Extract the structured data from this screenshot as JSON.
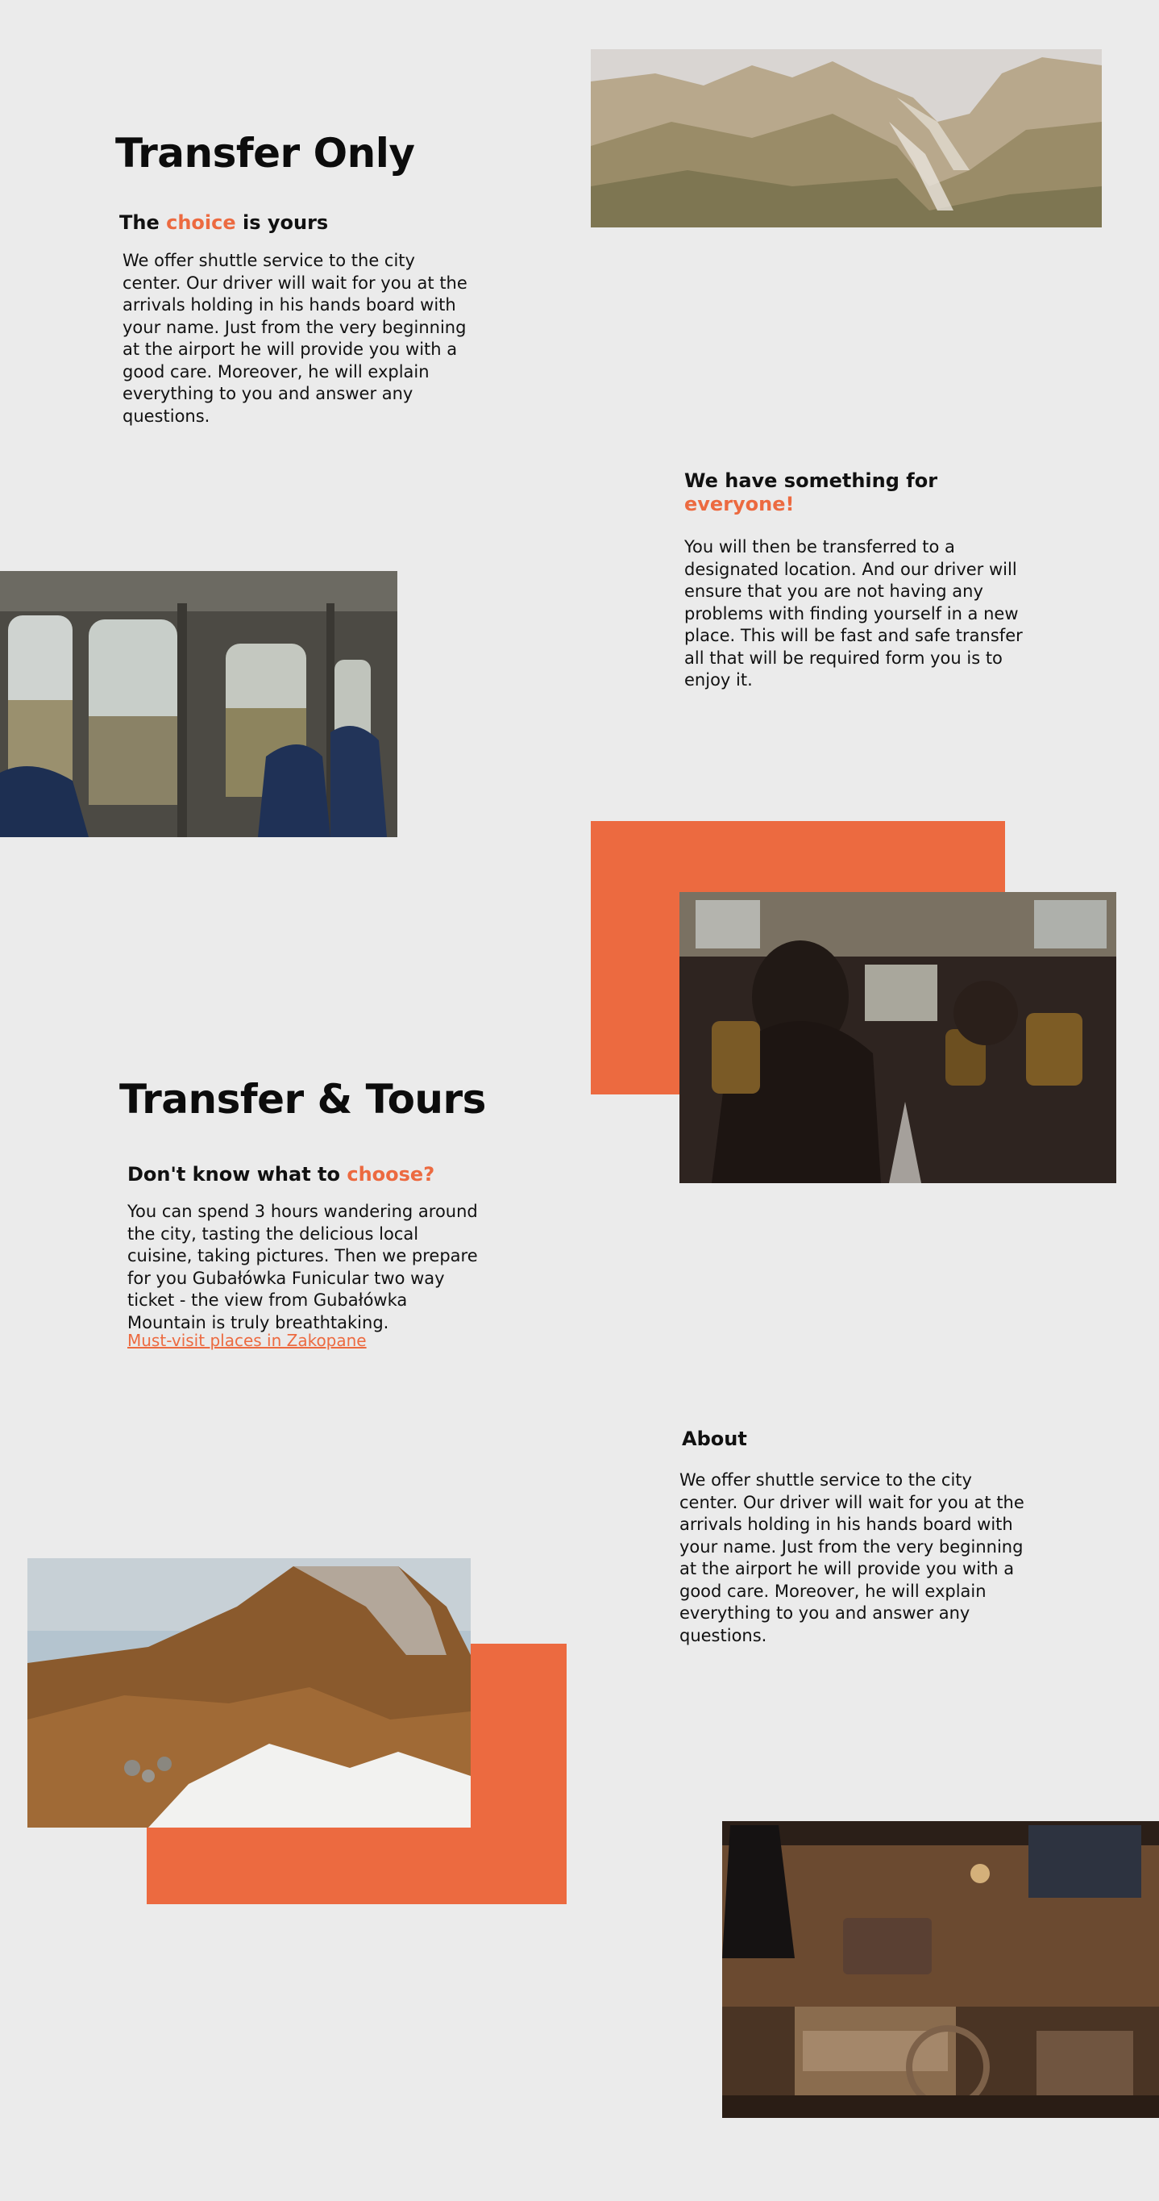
{
  "section1": {
    "title": "Transfer Only",
    "sub_pre": "The ",
    "sub_accent": "choice",
    "sub_post": " is yours",
    "body": "We offer shuttle service to the city center. Our driver will wait for you at the arrivals holding in his hands board with your name. Just from the very beginning at the airport he will provide you with a good care. Moreover, he will explain everything to you and answer any questions."
  },
  "section2": {
    "sub_line1": "We have something for",
    "sub_accent": "everyone!",
    "body": "You will then be transferred to a designated location. And our driver will ensure that you are not having any problems with finding yourself in a new place. This will be fast and safe transfer all that will be required form you is to enjoy it."
  },
  "section3": {
    "title": "Transfer & Tours",
    "sub_pre": "Don't know what to ",
    "sub_accent": "choose?",
    "body": "You can spend 3 hours wandering around the city, tasting the delicious local cuisine, taking pictures. Then we prepare for you Gubałówka Funicular two way ticket - the view from Gubałówka Mountain is truly breathtaking.",
    "link": "Must-visit places in Zakopane"
  },
  "section4": {
    "title": "About",
    "body": "We offer shuttle service to the city center. Our driver will wait for you at the arrivals holding in his hands board with your name. Just from the very beginning at the airport he will provide you with a good care. Moreover, he will explain everything to you and answer any questions."
  },
  "images": {
    "mountain_valley": "mountain-valley-photo",
    "train_interior": "train-interior-photo",
    "bus_interior": "bus-interior-photo",
    "mountain_slope": "mountain-slope-photo",
    "cabin_interior": "cabin-interior-photo"
  },
  "colors": {
    "background": "#ebebeb",
    "accent": "#ec6a40",
    "text": "#111111"
  }
}
